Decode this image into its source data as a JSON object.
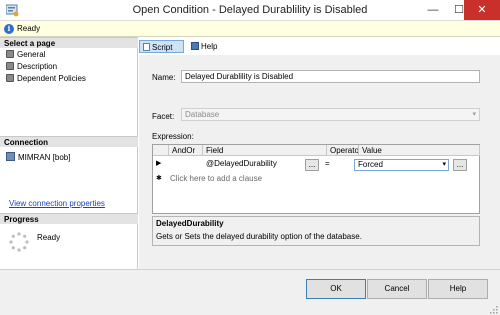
{
  "window": {
    "title": "Open Condition - Delayed Durablility is Disabled",
    "controls": {
      "minimize": "—",
      "maximize": "☐",
      "close": "✕"
    }
  },
  "status": {
    "text": "Ready",
    "icon": "info-icon"
  },
  "sidebar": {
    "select_page_header": "Select a page",
    "pages": [
      {
        "label": "General"
      },
      {
        "label": "Description"
      },
      {
        "label": "Dependent Policies"
      }
    ],
    "connection_header": "Connection",
    "connection_value": "MIMRAN [bob]",
    "view_connection_link": "View connection properties",
    "progress_header": "Progress",
    "progress_text": "Ready"
  },
  "toolbar": {
    "script_label": "Script",
    "script_arrow": "▾",
    "help_label": "Help"
  },
  "form": {
    "name_label": "Name:",
    "name_value": "Delayed Durablility is Disabled",
    "facet_label": "Facet:",
    "facet_value": "Database",
    "expression_label": "Expression:"
  },
  "grid": {
    "columns": [
      "AndOr",
      "Field",
      "Operato",
      "Value"
    ],
    "row": {
      "field": "@DelayedDurability",
      "operator": "=",
      "value": "Forced"
    },
    "add_clause": "Click here to add a clause",
    "row_marker": "▶",
    "new_marker": "✱",
    "ellipsis": "...",
    "combo_arrow": "▾"
  },
  "description": {
    "title": "DelayedDurability",
    "text": "Gets or Sets the delayed durability option of the database."
  },
  "buttons": {
    "ok": "OK",
    "cancel": "Cancel",
    "help": "Help"
  },
  "colors": {
    "accent": "#3c7fb1",
    "close": "#c9302c",
    "status_bg": "#ffffe1"
  }
}
